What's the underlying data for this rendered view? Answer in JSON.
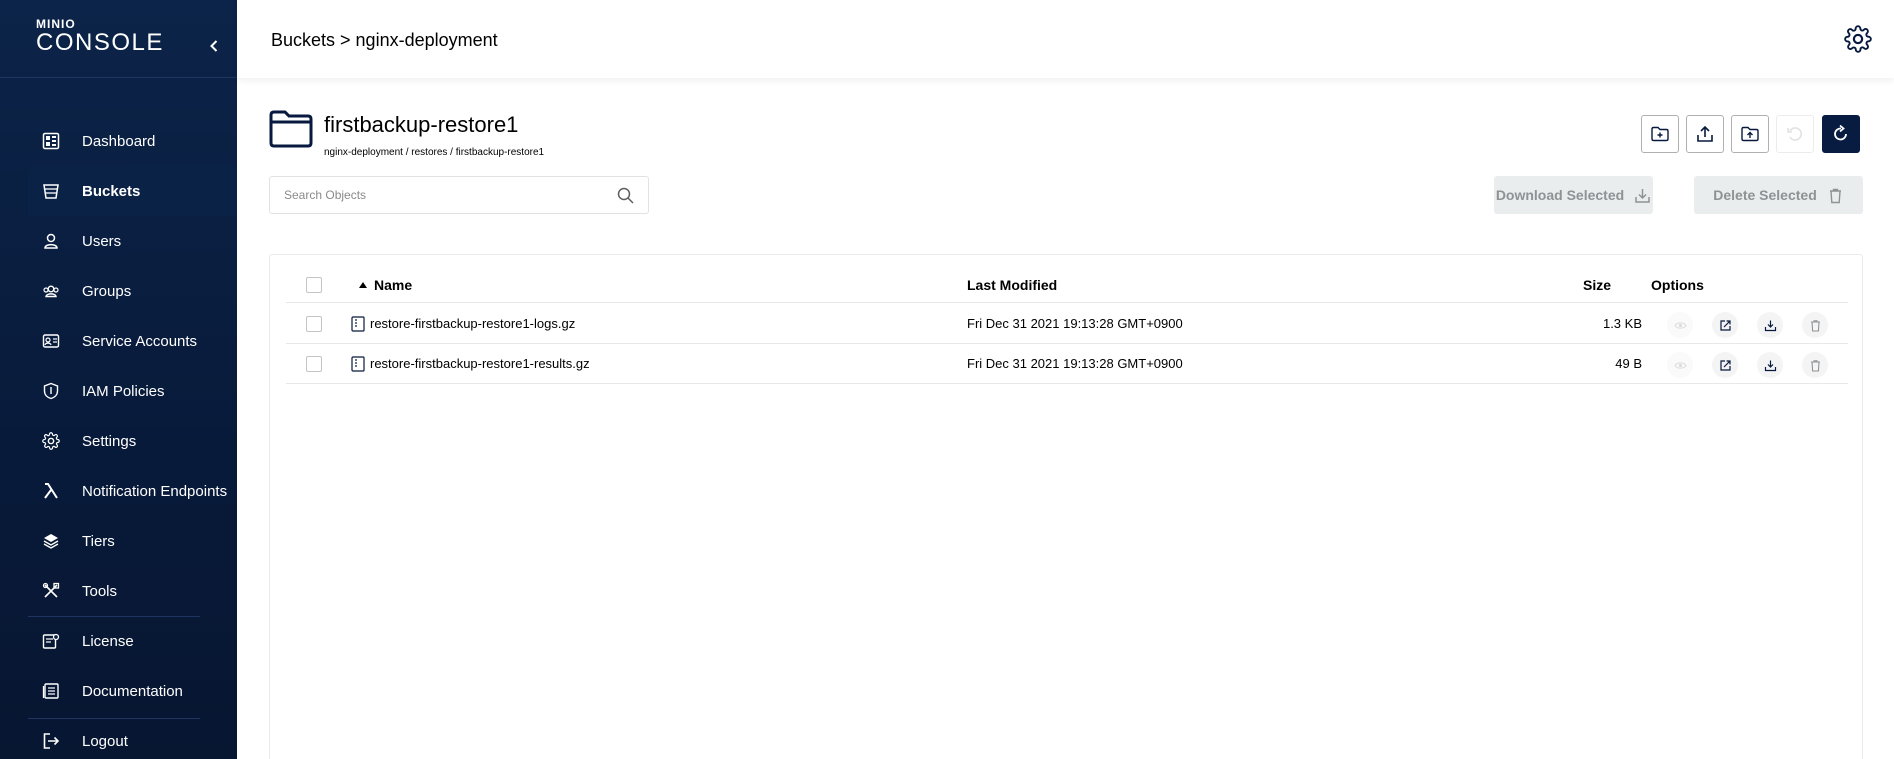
{
  "app": {
    "logo_top": "MINIO",
    "logo_main": "CONSOLE"
  },
  "sidebar": {
    "items": [
      {
        "label": "Dashboard",
        "icon": "dashboard-icon"
      },
      {
        "label": "Buckets",
        "icon": "bucket-icon",
        "active": true
      },
      {
        "label": "Users",
        "icon": "user-icon"
      },
      {
        "label": "Groups",
        "icon": "groups-icon"
      },
      {
        "label": "Service Accounts",
        "icon": "service-account-icon"
      },
      {
        "label": "IAM Policies",
        "icon": "shield-icon"
      },
      {
        "label": "Settings",
        "icon": "gear-icon"
      },
      {
        "label": "Notification Endpoints",
        "icon": "lambda-icon"
      },
      {
        "label": "Tiers",
        "icon": "layers-icon"
      },
      {
        "label": "Tools",
        "icon": "tools-icon"
      },
      {
        "label": "License",
        "icon": "license-icon"
      },
      {
        "label": "Documentation",
        "icon": "documentation-icon"
      },
      {
        "label": "Logout",
        "icon": "logout-icon"
      }
    ]
  },
  "header": {
    "breadcrumb": "Buckets > nginx-deployment"
  },
  "bucket": {
    "title": "firstbackup-restore1",
    "path": "nginx-deployment / restores / firstbackup-restore1"
  },
  "search": {
    "placeholder": "Search Objects",
    "value": ""
  },
  "actions": {
    "download_label": "Download Selected",
    "delete_label": "Delete Selected"
  },
  "toolbar": {
    "buttons": [
      "create-folder",
      "upload-file",
      "upload-folder",
      "rewind (disabled)",
      "refresh"
    ]
  },
  "table": {
    "columns": {
      "name": "Name",
      "last_modified": "Last Modified",
      "size": "Size",
      "options": "Options"
    },
    "sort": {
      "column": "Name",
      "direction": "ascending"
    },
    "rows": [
      {
        "name": "restore-firstbackup-restore1-logs.gz",
        "last_modified": "Fri Dec 31 2021 19:13:28 GMT+0900",
        "size": "1.3 KB"
      },
      {
        "name": "restore-firstbackup-restore1-results.gz",
        "last_modified": "Fri Dec 31 2021 19:13:28 GMT+0900",
        "size": "49 B"
      }
    ]
  },
  "colors": {
    "sidebar_bg": "#081a3a",
    "accent_dark": "#081c42",
    "button_disabled_bg": "#eaedee"
  }
}
